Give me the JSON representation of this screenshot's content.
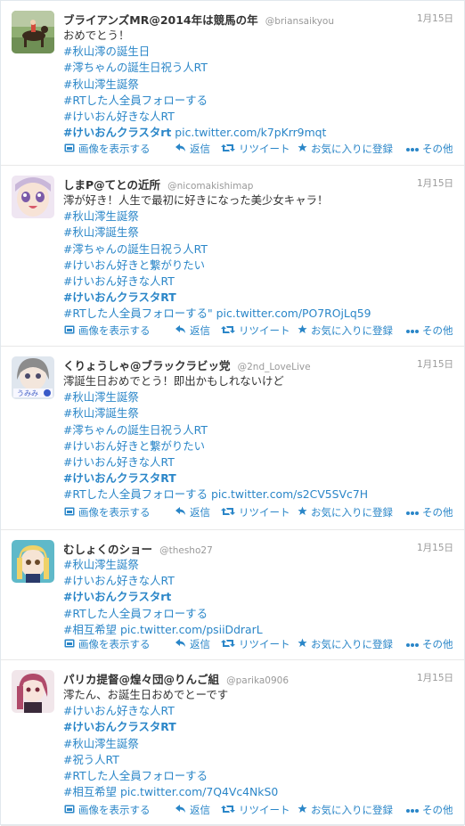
{
  "actions": {
    "media": "画像を表示する",
    "reply": "返信",
    "retweet": "リツイート",
    "favorite": "お気に入りに登録",
    "more": "その他"
  },
  "tweets": [
    {
      "name": "ブライアンズMR@2014年は競馬の年",
      "handle": "@briansaikyou",
      "time": "1月15日",
      "lines": [
        [
          {
            "t": "おめでとう！",
            "k": "plain"
          }
        ],
        [
          {
            "t": "#秋山澪の誕生日",
            "k": "hash"
          }
        ],
        [
          {
            "t": "#澪ちゃんの誕生日祝う人RT",
            "k": "hash"
          }
        ],
        [
          {
            "t": "#秋山澪生誕祭",
            "k": "hash"
          }
        ],
        [
          {
            "t": "#RTした人全員フォローする",
            "k": "hash"
          }
        ],
        [
          {
            "t": "#けいおん好きな人RT",
            "k": "hash"
          }
        ],
        [
          {
            "t": "#けいおんクラスタrt",
            "k": "hashbold"
          },
          {
            "t": "pic.twitter.com/k7pKrr9mqt",
            "k": "link"
          }
        ]
      ]
    },
    {
      "name": "しまP@てとの近所",
      "handle": "@nicomakishimap",
      "time": "1月15日",
      "lines": [
        [
          {
            "t": "澪が好き！人生で最初に好きになった美少女キャラ！",
            "k": "plain"
          }
        ],
        [
          {
            "t": "#秋山澪生誕祭",
            "k": "hash"
          }
        ],
        [
          {
            "t": "#秋山澪誕生祭",
            "k": "hash"
          }
        ],
        [
          {
            "t": "#澪ちゃんの誕生日祝う人RT",
            "k": "hash"
          }
        ],
        [
          {
            "t": "#けいおん好きと繋がりたい",
            "k": "hash"
          }
        ],
        [
          {
            "t": "#けいおん好きな人RT",
            "k": "hash"
          }
        ],
        [
          {
            "t": "#けいおんクラスタRT",
            "k": "hashbold"
          }
        ],
        [
          {
            "t": "#RTした人全員フォローする\"",
            "k": "hash"
          },
          {
            "t": "pic.twitter.com/PO7ROjLq59",
            "k": "link"
          }
        ]
      ]
    },
    {
      "name": "くりょうしゃ@ブラックラビッ党",
      "handle": "@2nd_LoveLive",
      "time": "1月15日",
      "lines": [
        [
          {
            "t": "澪誕生日おめでとう！即出かもしれないけど",
            "k": "plain"
          }
        ],
        [
          {
            "t": "#秋山澪生誕祭",
            "k": "hash"
          }
        ],
        [
          {
            "t": "#秋山澪誕生祭",
            "k": "hash"
          }
        ],
        [
          {
            "t": "#澪ちゃんの誕生日祝う人RT",
            "k": "hash"
          }
        ],
        [
          {
            "t": "#けいおん好きと繋がりたい",
            "k": "hash"
          }
        ],
        [
          {
            "t": "#けいおん好きな人RT",
            "k": "hash"
          }
        ],
        [
          {
            "t": "#けいおんクラスタRT",
            "k": "hashbold"
          }
        ],
        [
          {
            "t": "#RTした人全員フォローする",
            "k": "hash"
          },
          {
            "t": "pic.twitter.com/s2CV5SVc7H",
            "k": "link"
          }
        ]
      ]
    },
    {
      "name": "むしょくのショー",
      "handle": "@thesho27",
      "time": "1月15日",
      "lines": [
        [
          {
            "t": "#秋山澪生誕祭",
            "k": "hash"
          }
        ],
        [
          {
            "t": "#けいおん好きな人RT",
            "k": "hash"
          }
        ],
        [
          {
            "t": "#けいおんクラスタrt",
            "k": "hashbold"
          }
        ],
        [
          {
            "t": "#RTした人全員フォローする",
            "k": "hash"
          }
        ],
        [
          {
            "t": "#相互希望",
            "k": "hash"
          },
          {
            "t": "pic.twitter.com/psiiDdrarL",
            "k": "link"
          }
        ]
      ]
    },
    {
      "name": "パリカ提督@煌々団@りんご組",
      "handle": "@parika0906",
      "time": "1月15日",
      "lines": [
        [
          {
            "t": "澪たん、お誕生日おめでとーです",
            "k": "plain"
          }
        ],
        [
          {
            "t": "#けいおん好きな人RT",
            "k": "hash"
          }
        ],
        [
          {
            "t": "#けいおんクラスタRT",
            "k": "hashbold"
          }
        ],
        [
          {
            "t": "#秋山澪生誕祭",
            "k": "hash"
          }
        ],
        [
          {
            "t": "#祝う人RT",
            "k": "hash"
          }
        ],
        [
          {
            "t": "#RTした人全員フォローする",
            "k": "hash"
          }
        ],
        [
          {
            "t": "#相互希望",
            "k": "hash"
          },
          {
            "t": "pic.twitter.com/7Q4Vc4NkS0",
            "k": "link"
          }
        ]
      ]
    }
  ]
}
